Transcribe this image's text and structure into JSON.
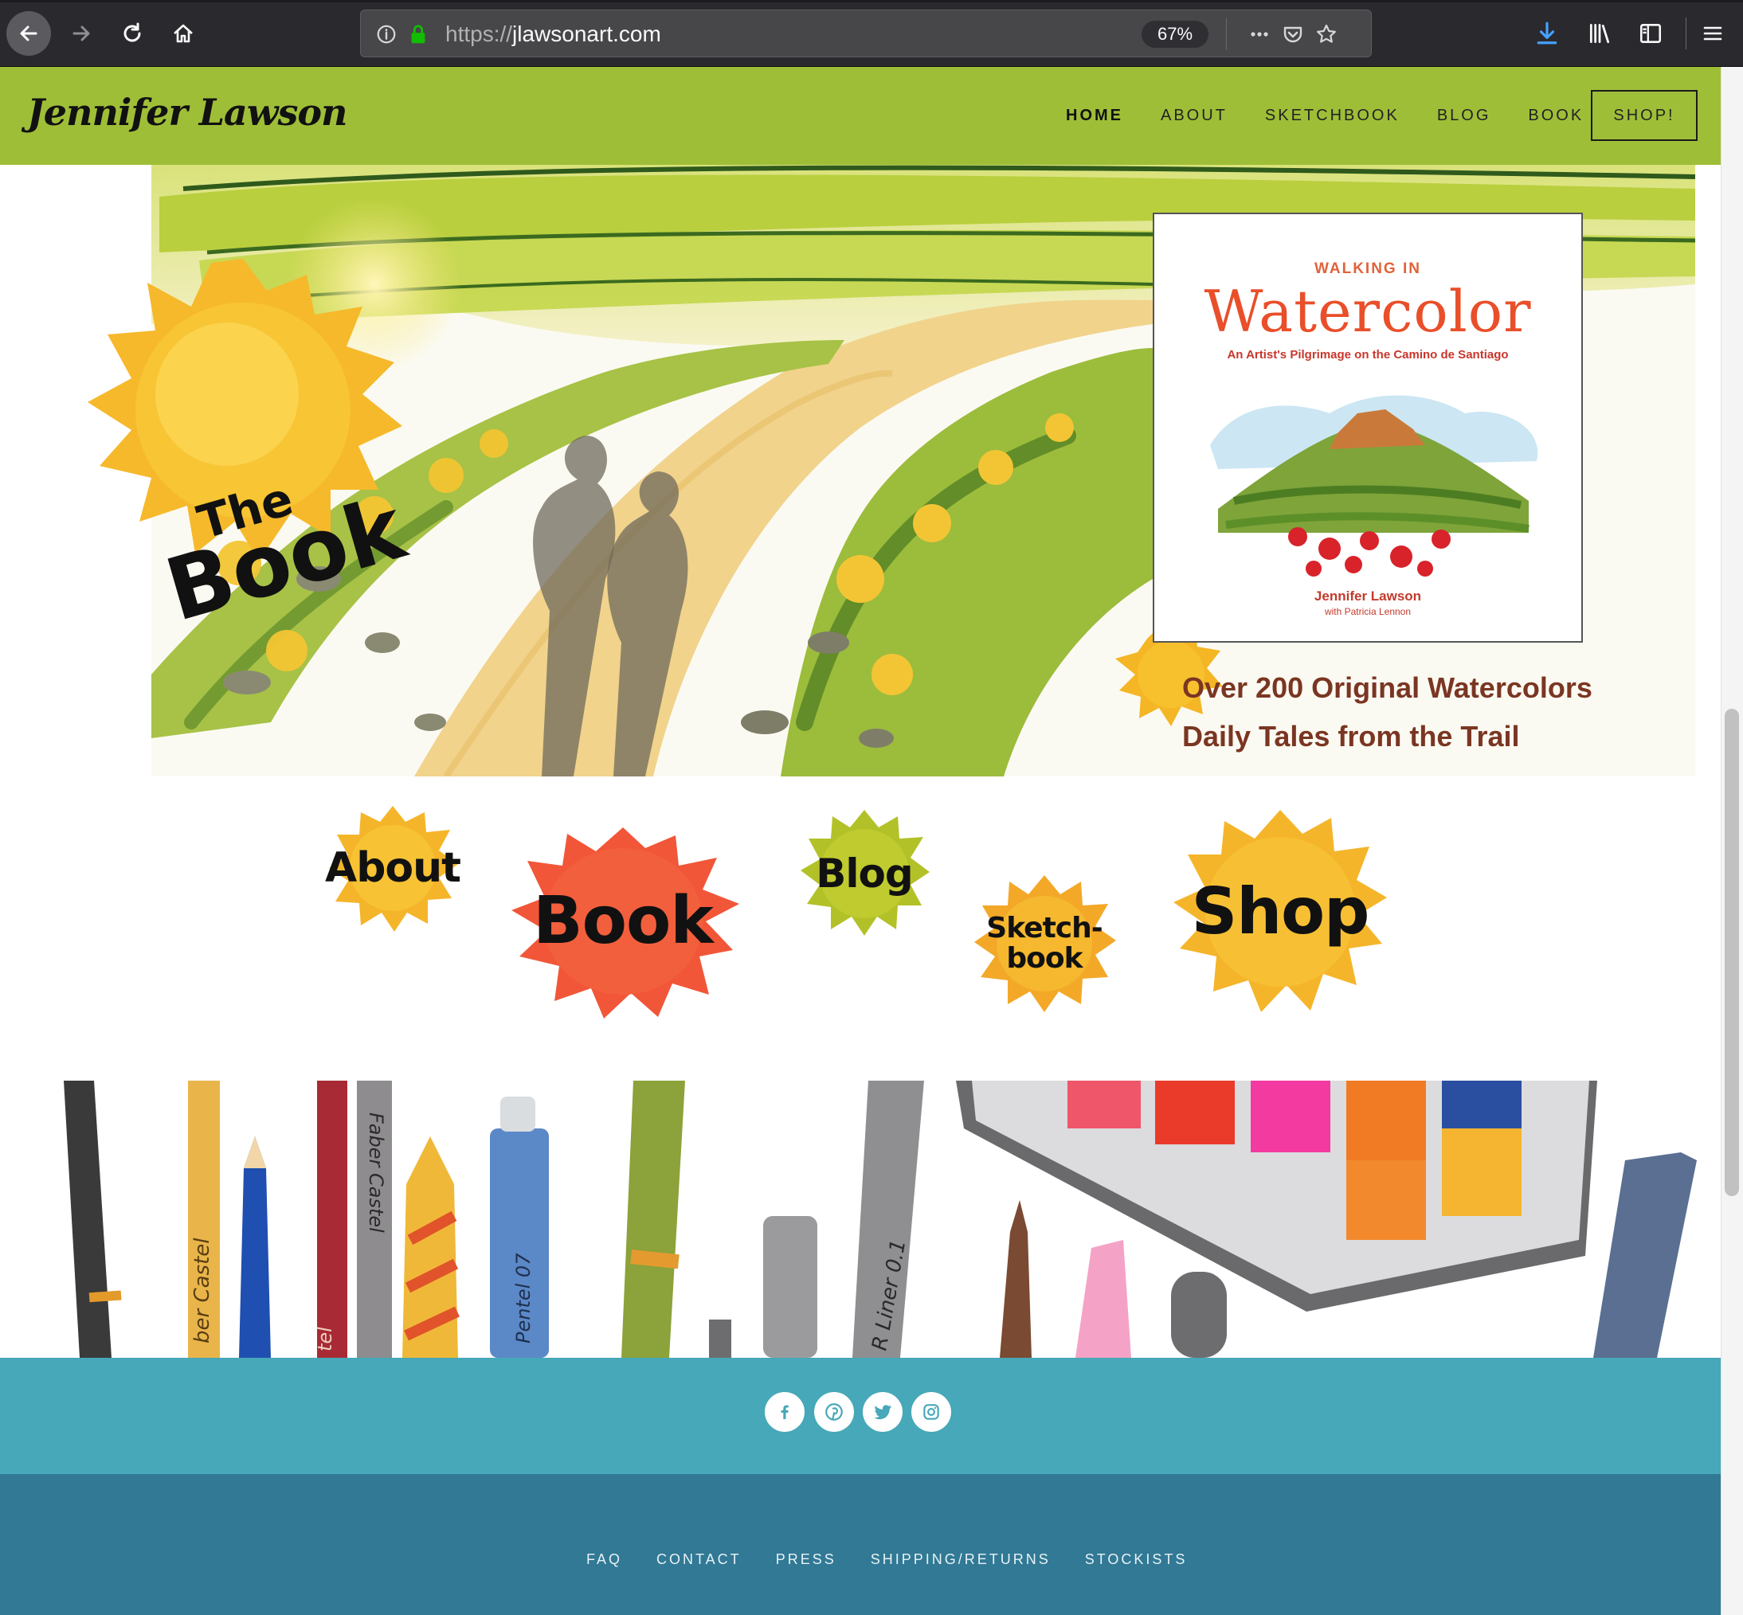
{
  "browser": {
    "url_scheme": "https://",
    "url_host": "jlawsonart.com",
    "zoom": "67%",
    "icons": [
      "back-icon",
      "forward-icon",
      "reload-icon",
      "home-icon",
      "info-icon",
      "lock-icon",
      "more-icon",
      "pocket-icon",
      "star-icon",
      "download-icon",
      "library-icon",
      "sidebar-icon",
      "menu-icon"
    ]
  },
  "header": {
    "logo": "Jennifer Lawson",
    "nav": [
      "HOME",
      "ABOUT",
      "SKETCHBOOK",
      "BLOG",
      "BOOK"
    ],
    "shop_label": "SHOP!"
  },
  "hero": {
    "badge_line1": "The",
    "badge_line2": "Book",
    "cover": {
      "kicker": "WALKING IN",
      "title": "Watercolor",
      "subtitle": "An Artist's Pilgrimage on the Camino de Santiago",
      "author": "Jennifer Lawson",
      "coauthor": "with Patricia Lennon"
    },
    "features": [
      "Over 200 Original Watercolors",
      "Daily Tales from the Trail"
    ]
  },
  "splash_nav": {
    "about": "About",
    "book": "Book",
    "blog": "Blog",
    "sketch_line1": "Sketch-",
    "sketch_line2": "book",
    "shop": "Shop"
  },
  "supplies_labels": {
    "pencil_a": "ber Castel",
    "pencil_b": "Faber Castel",
    "pencil_c": "Pentel 07",
    "pen_liner": "R Liner 0.1",
    "pencil_d": "tel"
  },
  "footer": {
    "social": [
      "facebook-icon",
      "pinterest-icon",
      "twitter-icon",
      "instagram-icon"
    ],
    "links": [
      "FAQ",
      "CONTACT",
      "PRESS",
      "SHIPPING/RETURNS",
      "STOCKISTS"
    ]
  },
  "colors": {
    "header_green": "#9fbe38",
    "social_teal": "#46a8b8",
    "footer_blue": "#317995",
    "splash_yellow": "#f6b92b",
    "splash_red": "#f25a3a",
    "splash_lime": "#b8c52a"
  }
}
